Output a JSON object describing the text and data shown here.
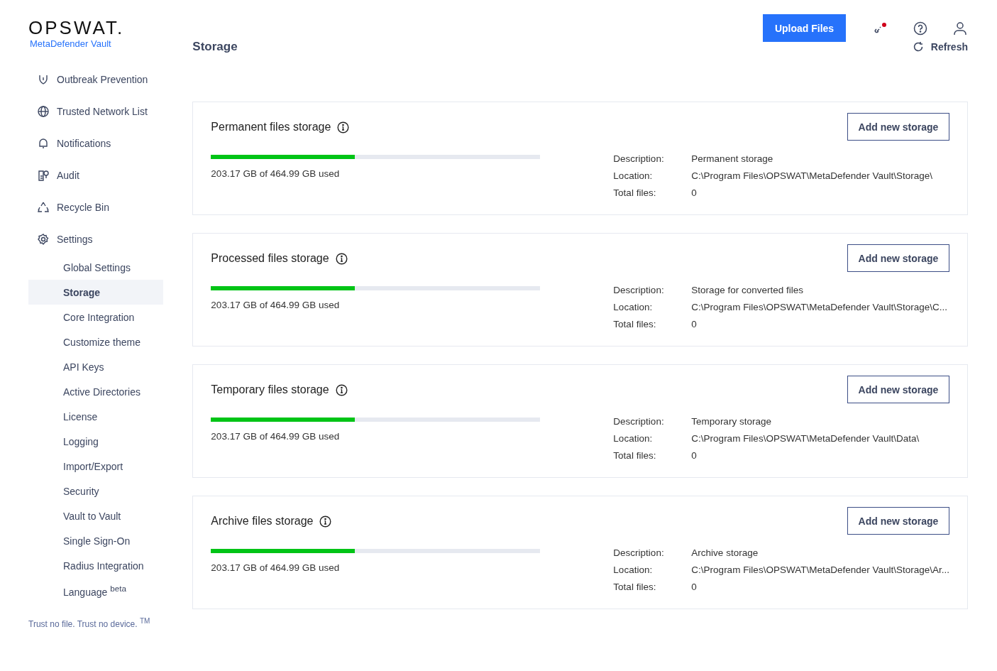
{
  "header": {
    "logo": "OPSWAT.",
    "product": "MetaDefender Vault",
    "upload_button": "Upload Files"
  },
  "sidebar": {
    "items": [
      {
        "label": "Outbreak Prevention"
      },
      {
        "label": "Trusted Network List"
      },
      {
        "label": "Notifications"
      },
      {
        "label": "Audit"
      },
      {
        "label": "Recycle Bin"
      },
      {
        "label": "Settings",
        "children": [
          {
            "label": "Global Settings",
            "selected": false
          },
          {
            "label": "Storage",
            "selected": true
          },
          {
            "label": "Core Integration",
            "selected": false
          },
          {
            "label": "Customize theme",
            "selected": false
          },
          {
            "label": "API Keys",
            "selected": false
          },
          {
            "label": "Active Directories",
            "selected": false
          },
          {
            "label": "License",
            "selected": false
          },
          {
            "label": "Logging",
            "selected": false
          },
          {
            "label": "Import/Export",
            "selected": false
          },
          {
            "label": "Security",
            "selected": false
          },
          {
            "label": "Vault to Vault",
            "selected": false
          },
          {
            "label": "Single Sign-On",
            "selected": false
          },
          {
            "label": "Radius Integration",
            "selected": false
          },
          {
            "label": "Language $^{beta}$",
            "selected": false
          }
        ]
      }
    ],
    "footer": "Trust no file. Trust no device. $^{TM}$"
  },
  "page": {
    "title": "Storage",
    "refresh": "Refresh"
  },
  "storages": [
    {
      "title": "Permanent files storage",
      "level": 0.437,
      "usage": "203.17 GB of 464.99 GB used",
      "button": "Add new storage",
      "details": [
        {
          "label": "Description:",
          "value": "Permanent storage"
        },
        {
          "label": "Location:",
          "value": "C:\\Program Files\\OPSWAT\\MetaDefender Vault\\Storage\\"
        },
        {
          "label": "Total files:",
          "value": "0"
        }
      ]
    },
    {
      "title": "Processed files storage",
      "level": 0.437,
      "usage": "203.17 GB of 464.99 GB used",
      "button": "Add new storage",
      "details": [
        {
          "label": "Description:",
          "value": "Storage for converted files"
        },
        {
          "label": "Location:",
          "value": "C:\\Program Files\\OPSWAT\\MetaDefender Vault\\Storage\\C..."
        },
        {
          "label": "Total files:",
          "value": "0"
        }
      ]
    },
    {
      "title": "Temporary files storage",
      "level": 0.437,
      "usage": "203.17 GB of 464.99 GB used",
      "button": "Add new storage",
      "details": [
        {
          "label": "Description:",
          "value": "Temporary storage"
        },
        {
          "label": "Location:",
          "value": "C:\\Program Files\\OPSWAT\\MetaDefender Vault\\Data\\"
        },
        {
          "label": "Total files:",
          "value": "0"
        }
      ]
    },
    {
      "title": "Archive files storage",
      "level": 0.437,
      "usage": "203.17 GB of 464.99 GB used",
      "button": "Add new storage",
      "details": [
        {
          "label": "Description:",
          "value": "Archive storage"
        },
        {
          "label": "Location:",
          "value": "C:\\Program Files\\OPSWAT\\MetaDefender Vault\\Storage\\Ar..."
        },
        {
          "label": "Total files:",
          "value": "0"
        }
      ]
    }
  ]
}
